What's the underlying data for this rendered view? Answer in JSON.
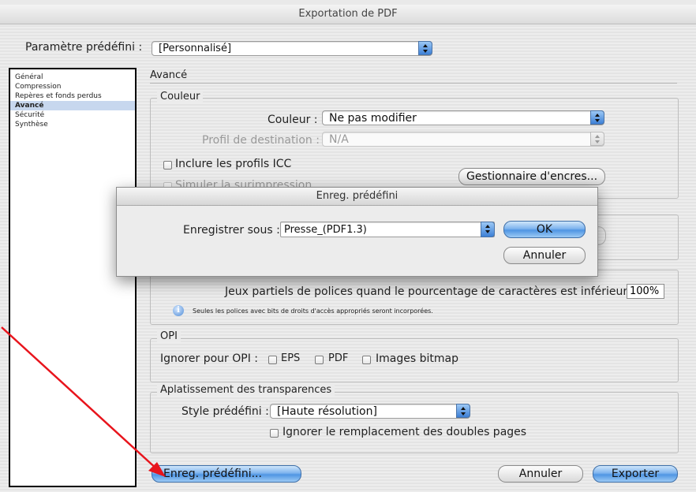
{
  "window": {
    "title": "Exportation de PDF"
  },
  "preset": {
    "label": "Paramètre prédéfini :",
    "value": "[Personnalisé]"
  },
  "sidebar": {
    "items": [
      {
        "label": "Général"
      },
      {
        "label": "Compression"
      },
      {
        "label": "Repères et fonds perdus"
      },
      {
        "label": "Avancé",
        "selected": true
      },
      {
        "label": "Sécurité"
      },
      {
        "label": "Synthèse"
      }
    ]
  },
  "section": {
    "title": "Avancé"
  },
  "couleur": {
    "group_label": "Couleur",
    "color_label": "Couleur :",
    "color_value": "Ne pas modifier",
    "profile_label": "Profil de destination :",
    "profile_value": "N/A",
    "icc_label": "Inclure les profils ICC",
    "simulate_label": "Simuler la surimpression",
    "ink_button": "Gestionnaire d'encres..."
  },
  "fonts": {
    "subset_label": "Jeux partiels de polices quand le pourcentage de caractères est inférieur à :",
    "subset_value": "100%",
    "info_text": "Seules les polices avec bits de droits d'accès appropriés seront incorporées."
  },
  "opi": {
    "group_label": "OPI",
    "ignore_label": "Ignorer pour OPI :",
    "eps_label": "EPS",
    "pdf_label": "PDF",
    "bitmap_label": "Images bitmap"
  },
  "transparency": {
    "group_label": "Aplatissement des transparences",
    "style_label": "Style prédéfini :",
    "style_value": "[Haute résolution]",
    "spread_label": "Ignorer le remplacement des doubles pages"
  },
  "footer": {
    "save_preset": "Enreg. prédéfini...",
    "cancel": "Annuler",
    "export": "Exporter"
  },
  "dialog": {
    "title": "Enreg. prédéfini",
    "save_as_label": "Enregistrer sous :",
    "save_as_value": "Presse_(PDF1.3)",
    "ok": "OK",
    "cancel": "Annuler"
  },
  "colors": {
    "arrow": "#e8141c",
    "accent_blue": "#4f95e3"
  }
}
